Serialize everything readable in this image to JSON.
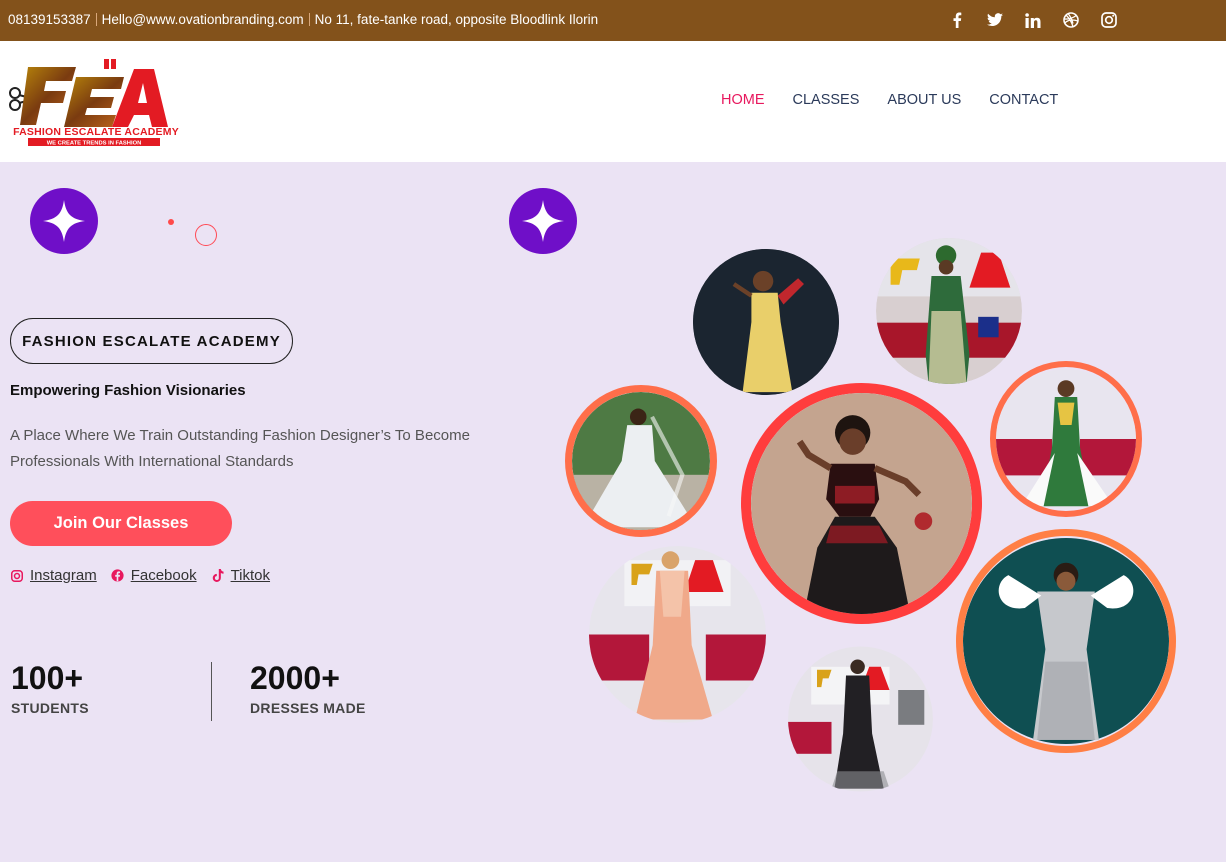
{
  "topbar": {
    "phone": "08139153387",
    "email": "Hello@www.ovationbranding.com",
    "address": "No 11, fate-tanke road, opposite Bloodlink Ilorin",
    "social_icons": [
      "facebook-icon",
      "twitter-icon",
      "linkedin-icon",
      "dribbble-icon",
      "instagram-icon"
    ]
  },
  "logo": {
    "letters": "FEA",
    "name": "FASHION ESCALATE ACADEMY",
    "tagline": "WE CREATE TRENDS IN FASHION"
  },
  "nav": {
    "items": [
      {
        "label": "HOME",
        "active": true
      },
      {
        "label": "CLASSES",
        "active": false
      },
      {
        "label": "ABOUT US",
        "active": false
      },
      {
        "label": "CONTACT",
        "active": false
      }
    ]
  },
  "hero": {
    "badge": "FASHION ESCALATE ACADEMY",
    "subtitle": "Empowering Fashion Visionaries",
    "description": "A Place Where We Train Outstanding Fashion Designer’s To Become Professionals With International Standards",
    "cta": "Join Our Classes",
    "social_links": [
      {
        "label": "Instagram",
        "icon": "instagram-icon"
      },
      {
        "label": "Facebook",
        "icon": "facebook-icon"
      },
      {
        "label": "Tiktok",
        "icon": "tiktok-icon"
      }
    ]
  },
  "stats": [
    {
      "value": "100+",
      "label": "STUDENTS"
    },
    {
      "value": "2000+",
      "label": "DRESSES MADE"
    }
  ],
  "colors": {
    "topbar": "#83521b",
    "background": "#ebe3f4",
    "accent": "#ff4f5b",
    "nav_active": "#e8185e",
    "sparkle": "#6f0fc8"
  }
}
